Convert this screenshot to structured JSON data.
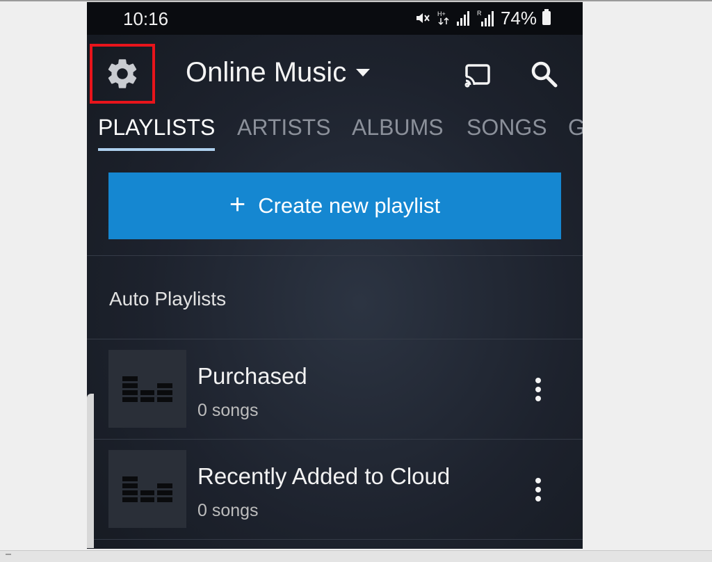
{
  "status_bar": {
    "time": "10:16",
    "battery": "74%"
  },
  "toolbar": {
    "settings_icon": "gear-icon",
    "title": "Online Music",
    "cast_icon": "cast-icon",
    "search_icon": "search-icon",
    "highlight_color": "#e8141b"
  },
  "tabs": [
    {
      "label": "PLAYLISTS",
      "active": true
    },
    {
      "label": "ARTISTS",
      "active": false
    },
    {
      "label": "ALBUMS",
      "active": false
    },
    {
      "label": "SONGS",
      "active": false
    },
    {
      "label": "G",
      "active": false
    }
  ],
  "create_button": {
    "label": "Create new playlist",
    "color": "#1587d1"
  },
  "section": {
    "heading": "Auto Playlists"
  },
  "playlists": [
    {
      "title": "Purchased",
      "subtitle": "0 songs"
    },
    {
      "title": "Recently Added to Cloud",
      "subtitle": "0 songs"
    }
  ]
}
